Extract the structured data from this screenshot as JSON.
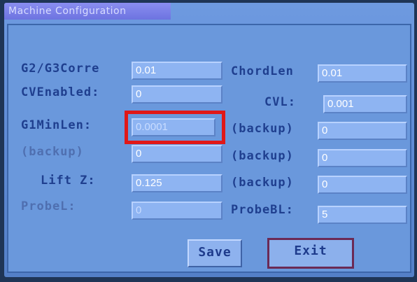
{
  "window": {
    "title": "Machine Configuration"
  },
  "left_fields": [
    {
      "label": "G2/G3Corre",
      "value": "0.01"
    },
    {
      "label": "CVEnabled:",
      "value": "0"
    },
    {
      "label": "G1MinLen:",
      "value": "0.0001"
    },
    {
      "label": "(backup)",
      "value": "0"
    },
    {
      "label": "Lift Z:",
      "value": "0.125"
    },
    {
      "label": "ProbeL:",
      "value": "0"
    }
  ],
  "right_fields": [
    {
      "label": "ChordLen",
      "value": "0.01"
    },
    {
      "label": "CVL:",
      "value": "0.001"
    },
    {
      "label": "(backup)",
      "value": "0"
    },
    {
      "label": "(backup)",
      "value": "0"
    },
    {
      "label": "(backup)",
      "value": "0"
    },
    {
      "label": "ProbeBL:",
      "value": "5"
    }
  ],
  "buttons": {
    "save": "Save",
    "exit": "Exit"
  },
  "colors": {
    "highlight": "#e01818",
    "screen_bg": "#6a98dc"
  }
}
